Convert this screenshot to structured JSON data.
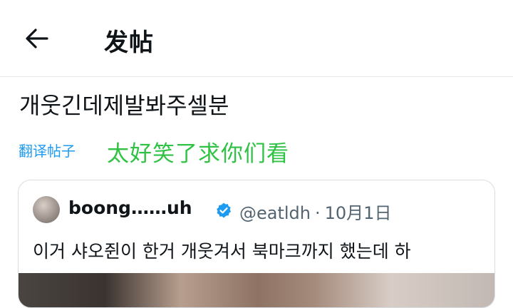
{
  "header": {
    "back_icon": "arrow-left-icon",
    "title": "发帖"
  },
  "post": {
    "text": "개웃긴데제발봐주셀분",
    "translate_label": "翻译帖子",
    "translated_text": "太好笑了求你们看"
  },
  "quote": {
    "display_name": "boong……uh",
    "handle": "@eatldh",
    "separator": "·",
    "date": "10月1日",
    "text": "이거 샤오쥔이 한거 개웃겨서 북마크까지 했는데 하",
    "verified_icon": "verified-badge-icon",
    "verified_color": "#1d9bf0"
  },
  "colors": {
    "link": "#1d9bf0",
    "translated_text": "#2fc244",
    "secondary_text": "#536471"
  }
}
